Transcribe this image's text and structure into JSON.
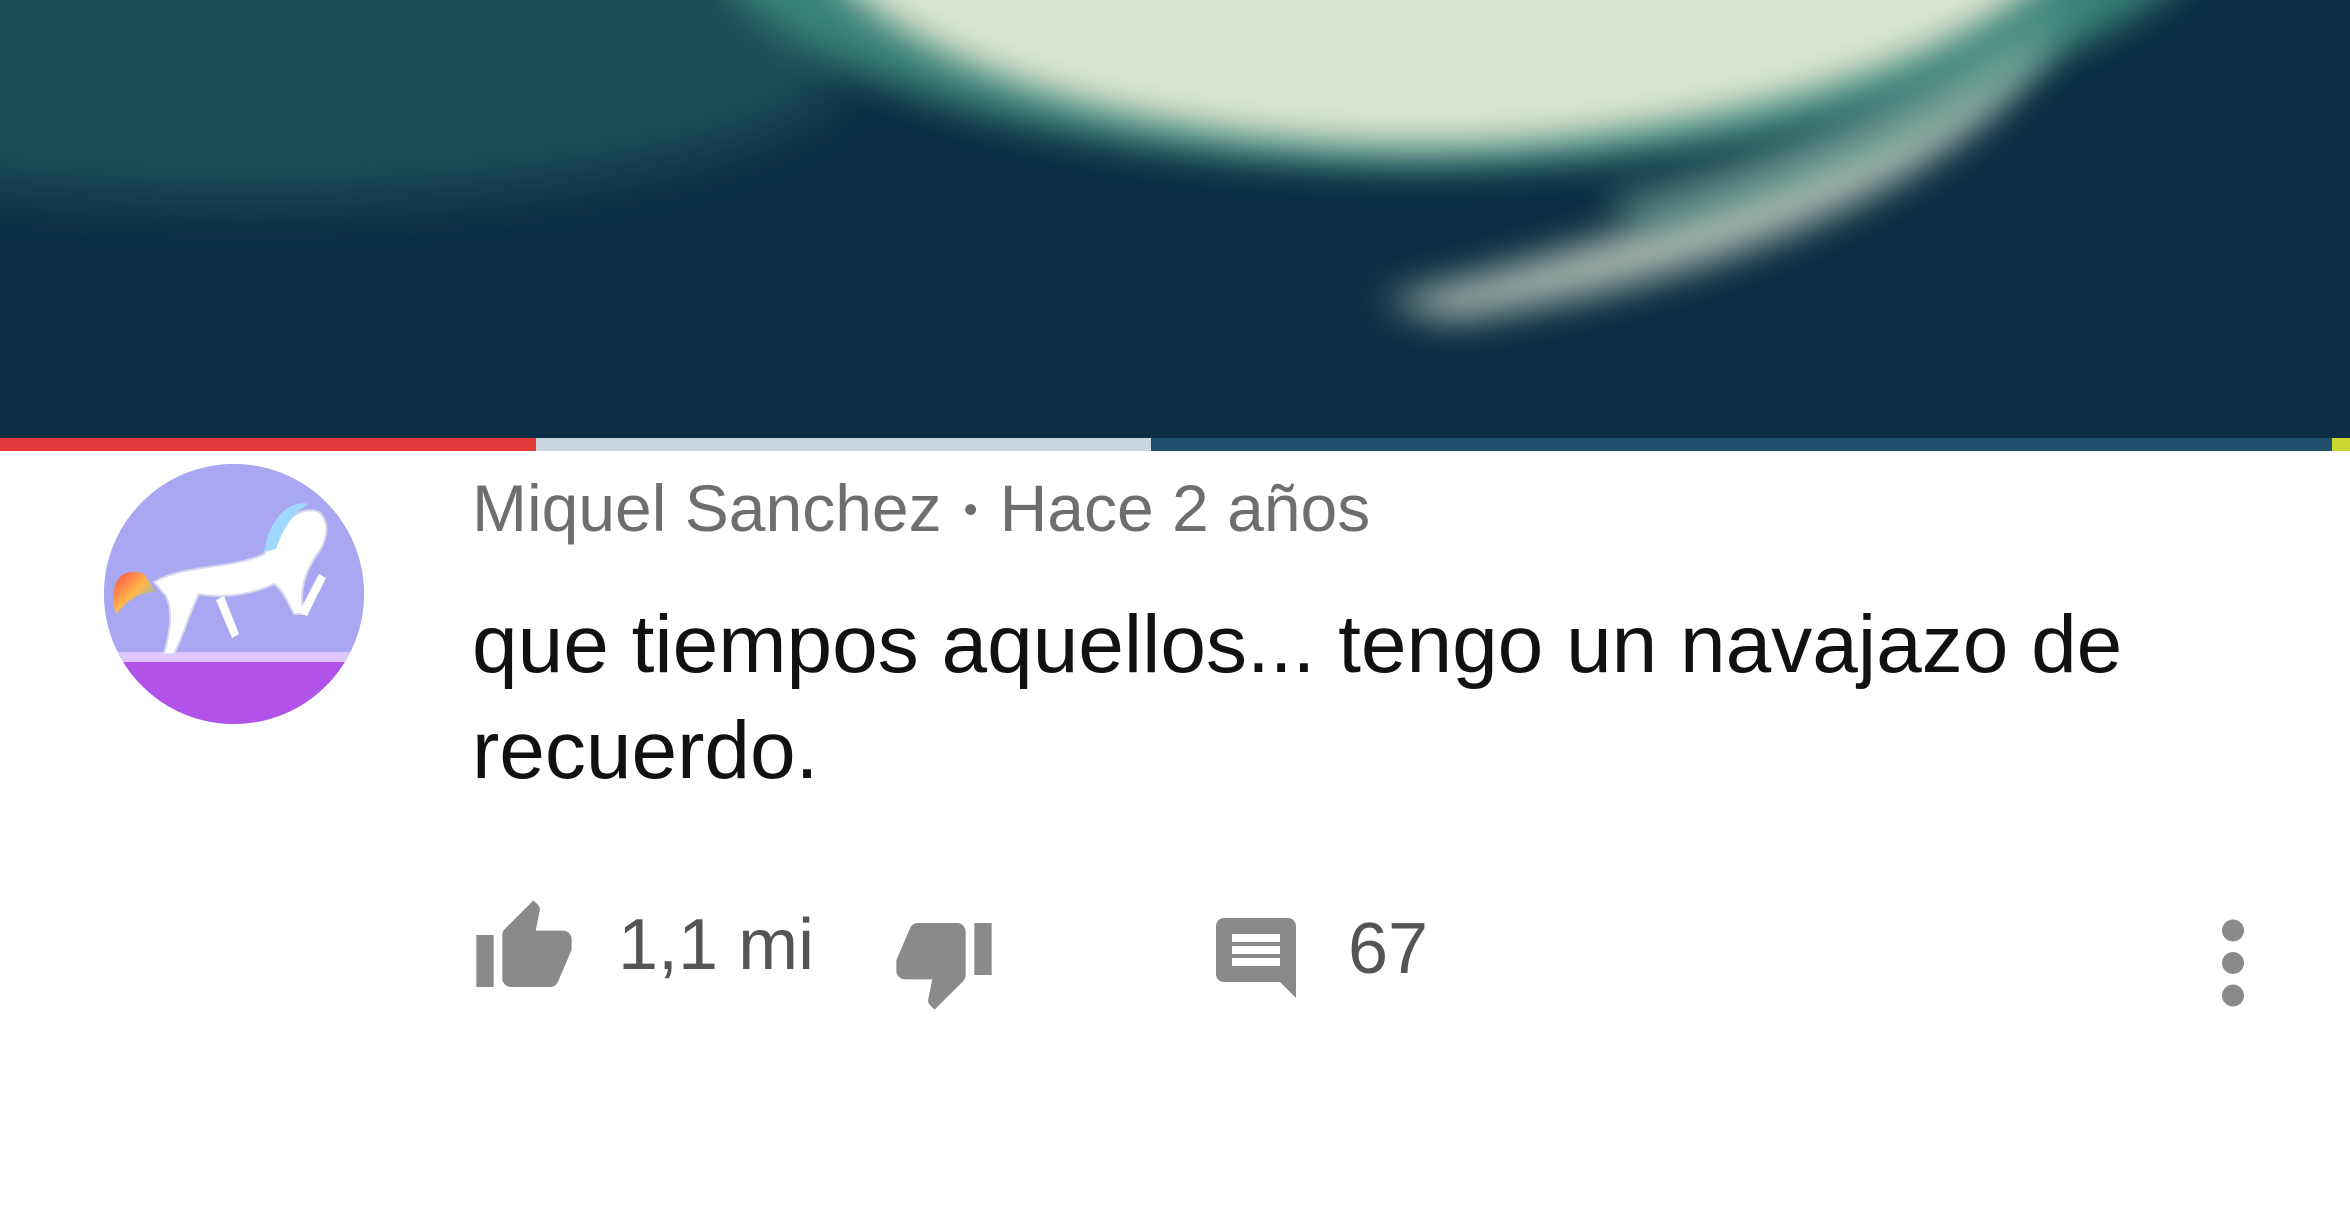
{
  "video": {
    "thumbnail_icon": "swirl-thumbnail",
    "progress_played": 0.228,
    "progress_buffered": 0.49,
    "colors": {
      "background": "#0c2d44",
      "played": "#e03a3a",
      "buffered": "#c9d6df",
      "track": "#1f4f6b"
    }
  },
  "comment": {
    "author": "Miquel Sanchez",
    "separator": "•",
    "timestamp": "Hace 2 años",
    "text": "que tiempos aquellos... tengo un navajazo de recuerdo.",
    "avatar_icon": "white-horse-avatar"
  },
  "actions": {
    "like_icon": "thumbs-up-icon",
    "like_count": "1,1 mi",
    "dislike_icon": "thumbs-down-icon",
    "reply_icon": "comment-icon",
    "reply_count": "67",
    "more_icon": "more-vertical-icon"
  }
}
